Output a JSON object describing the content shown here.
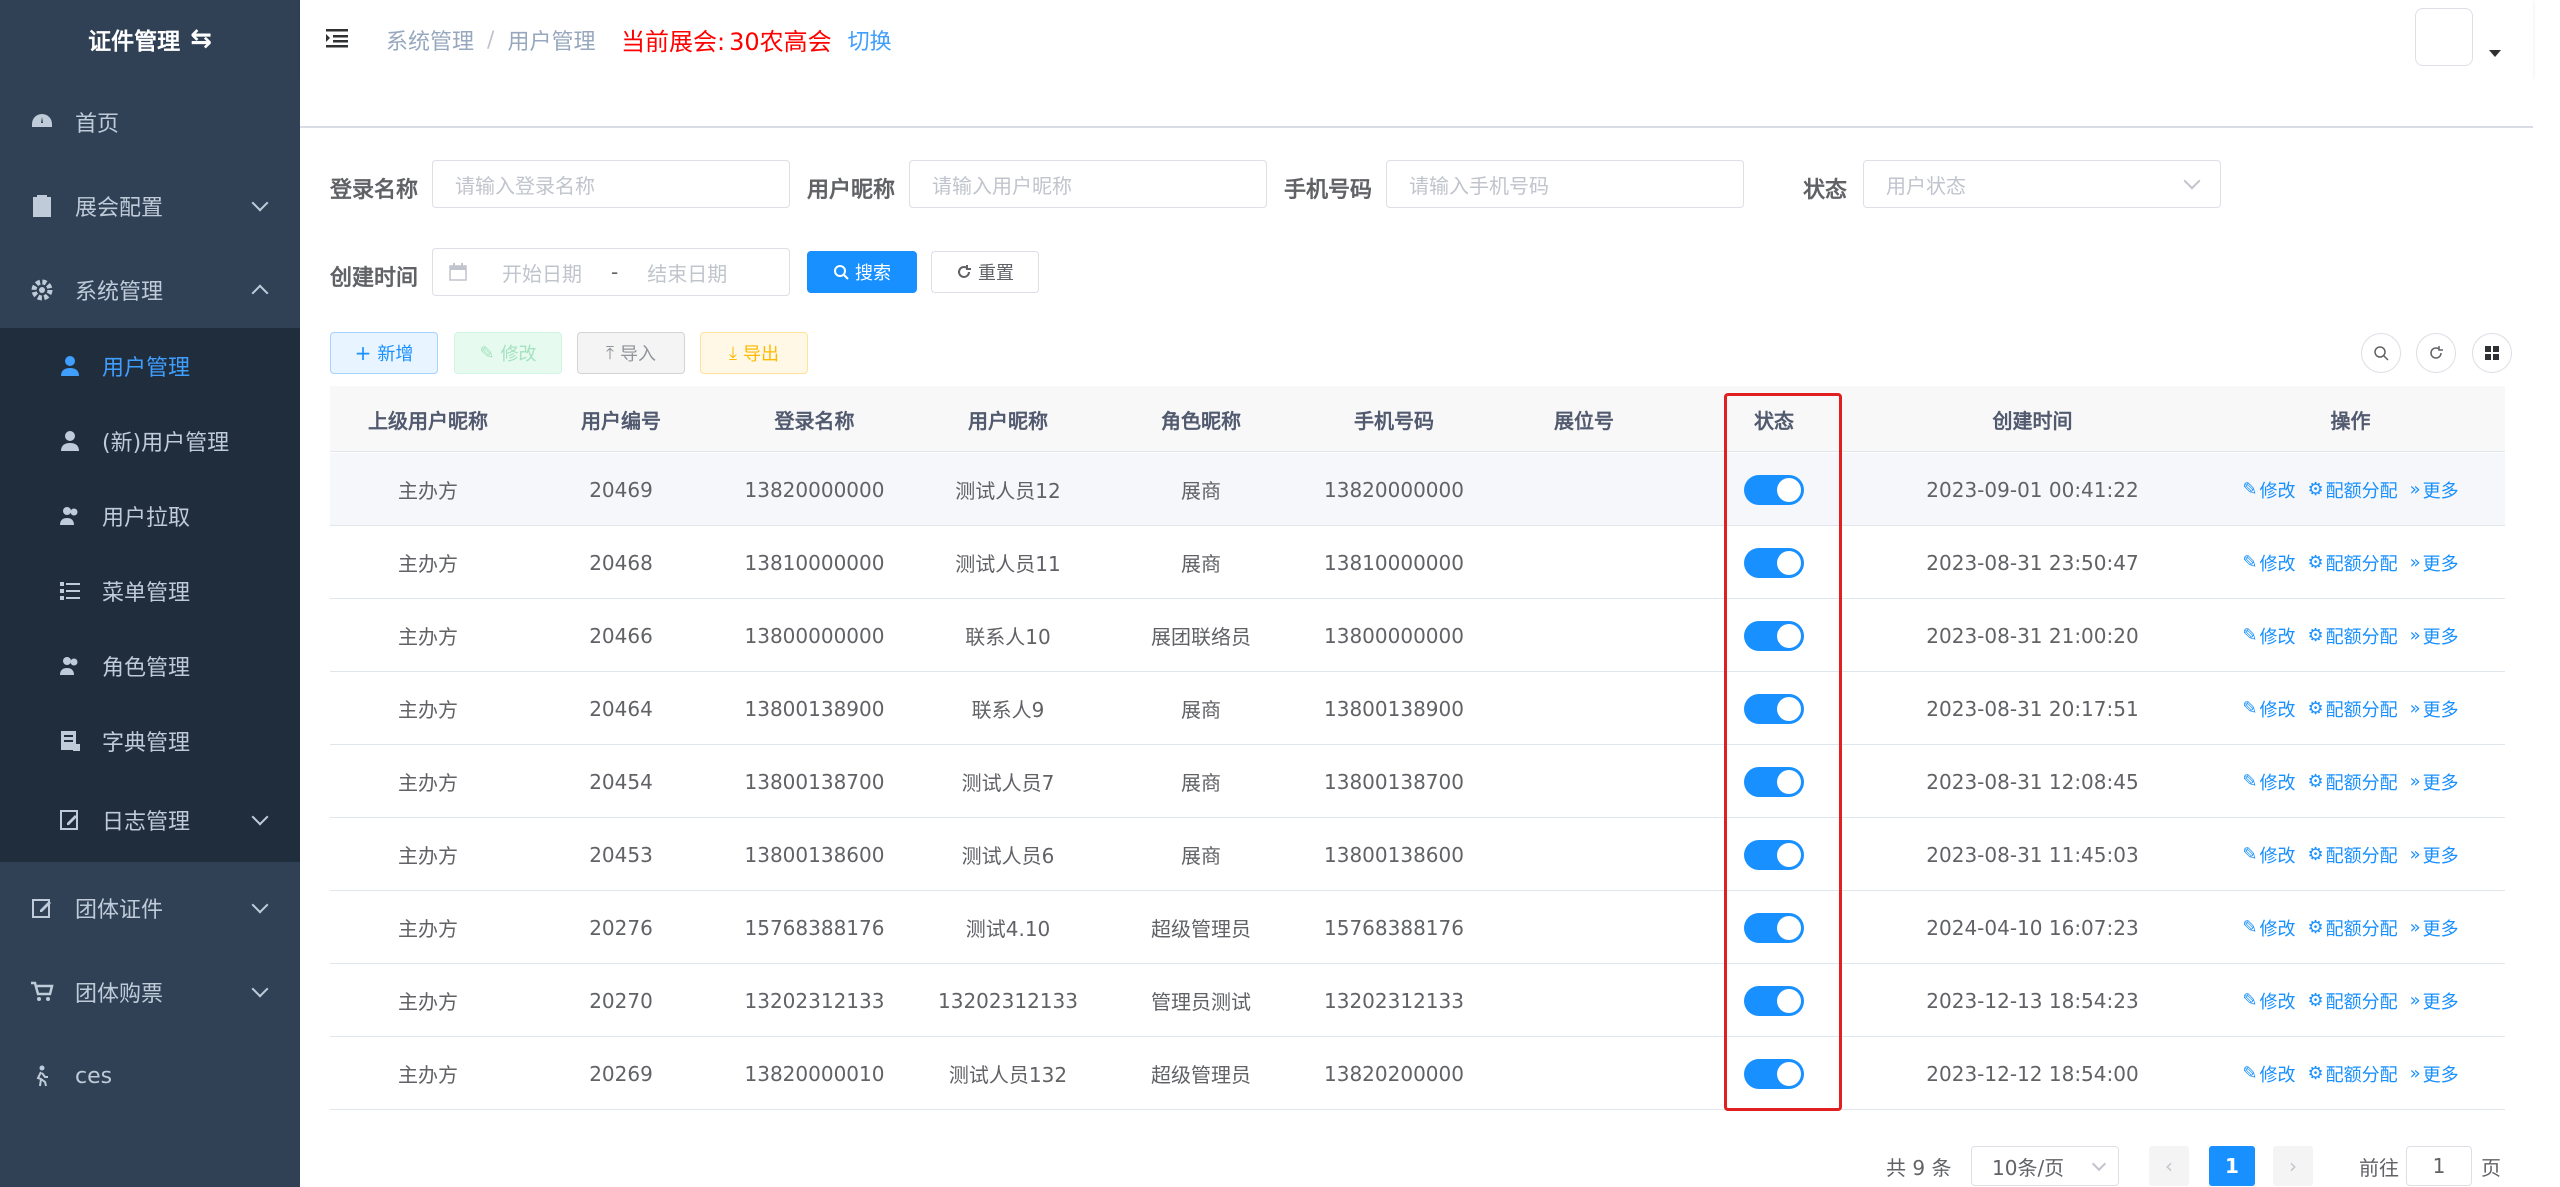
{
  "sidebar": {
    "title": "证件管理",
    "items": [
      {
        "label": "首页",
        "icon": "dashboard-icon"
      },
      {
        "label": "展会配置",
        "icon": "clipboard-icon"
      },
      {
        "label": "系统管理",
        "icon": "gear-icon"
      },
      {
        "label": "团体证件",
        "icon": "edit-icon"
      },
      {
        "label": "团体购票",
        "icon": "cart-icon"
      },
      {
        "label": "ces",
        "icon": "walk-icon"
      }
    ],
    "submenu": [
      {
        "label": "用户管理",
        "icon": "user-icon"
      },
      {
        "label": "(新)用户管理",
        "icon": "user-icon"
      },
      {
        "label": "用户拉取",
        "icon": "peoples-icon"
      },
      {
        "label": "菜单管理",
        "icon": "tree-table-icon"
      },
      {
        "label": "角色管理",
        "icon": "peoples-icon"
      },
      {
        "label": "字典管理",
        "icon": "dict-icon"
      },
      {
        "label": "日志管理",
        "icon": "log-icon"
      }
    ]
  },
  "header": {
    "breadcrumb": [
      "系统管理",
      "用户管理"
    ],
    "expo_label": "当前展会:",
    "expo_value": "30农高会",
    "switch_label": "切换"
  },
  "filters": {
    "login_name": {
      "label": "登录名称",
      "placeholder": "请输入登录名称"
    },
    "nickname": {
      "label": "用户昵称",
      "placeholder": "请输入用户昵称"
    },
    "phone": {
      "label": "手机号码",
      "placeholder": "请输入手机号码"
    },
    "status": {
      "label": "状态",
      "placeholder": "用户状态"
    },
    "created": {
      "label": "创建时间",
      "start": "开始日期",
      "sep": "-",
      "end": "结束日期"
    },
    "search_label": "搜索",
    "reset_label": "重置"
  },
  "toolbar": {
    "add": "新增",
    "edit": "修改",
    "import": "导入",
    "export": "导出"
  },
  "table": {
    "columns": [
      "上级用户昵称",
      "用户编号",
      "登录名称",
      "用户昵称",
      "角色昵称",
      "手机号码",
      "展位号",
      "状态",
      "创建时间",
      "操作"
    ],
    "rows": [
      {
        "parent": "主办方",
        "id": "20469",
        "login": "13820000000",
        "nick": "测试人员12",
        "role": "展商",
        "phone": "13820000000",
        "booth": "",
        "status": true,
        "created": "2023-09-01 00:41:22"
      },
      {
        "parent": "主办方",
        "id": "20468",
        "login": "13810000000",
        "nick": "测试人员11",
        "role": "展商",
        "phone": "13810000000",
        "booth": "",
        "status": true,
        "created": "2023-08-31 23:50:47"
      },
      {
        "parent": "主办方",
        "id": "20466",
        "login": "13800000000",
        "nick": "联系人10",
        "role": "展团联络员",
        "phone": "13800000000",
        "booth": "",
        "status": true,
        "created": "2023-08-31 21:00:20"
      },
      {
        "parent": "主办方",
        "id": "20464",
        "login": "13800138900",
        "nick": "联系人9",
        "role": "展商",
        "phone": "13800138900",
        "booth": "",
        "status": true,
        "created": "2023-08-31 20:17:51"
      },
      {
        "parent": "主办方",
        "id": "20454",
        "login": "13800138700",
        "nick": "测试人员7",
        "role": "展商",
        "phone": "13800138700",
        "booth": "",
        "status": true,
        "created": "2023-08-31 12:08:45"
      },
      {
        "parent": "主办方",
        "id": "20453",
        "login": "13800138600",
        "nick": "测试人员6",
        "role": "展商",
        "phone": "13800138600",
        "booth": "",
        "status": true,
        "created": "2023-08-31 11:45:03"
      },
      {
        "parent": "主办方",
        "id": "20276",
        "login": "15768388176",
        "nick": "测试4.10",
        "role": "超级管理员",
        "phone": "15768388176",
        "booth": "",
        "status": true,
        "created": "2024-04-10 16:07:23"
      },
      {
        "parent": "主办方",
        "id": "20270",
        "login": "13202312133",
        "nick": "13202312133",
        "role": "管理员测试",
        "phone": "13202312133",
        "booth": "",
        "status": true,
        "created": "2023-12-13 18:54:23"
      },
      {
        "parent": "主办方",
        "id": "20269",
        "login": "13820000010",
        "nick": "测试人员132",
        "role": "超级管理员",
        "phone": "13820200000",
        "booth": "",
        "status": true,
        "created": "2023-12-12 18:54:00"
      }
    ],
    "ops": {
      "edit": "修改",
      "quota": "配额分配",
      "more": "更多"
    }
  },
  "pagination": {
    "total": "共 9 条",
    "page_size": "10条/页",
    "current": "1",
    "goto_prefix": "前往",
    "goto_value": "1",
    "goto_suffix": "页"
  },
  "colors": {
    "sidebar_bg": "#304156",
    "submenu_bg": "#1f2d3d",
    "primary": "#1890ff",
    "highlight": "#e02020",
    "expo_red": "#ff0000"
  }
}
